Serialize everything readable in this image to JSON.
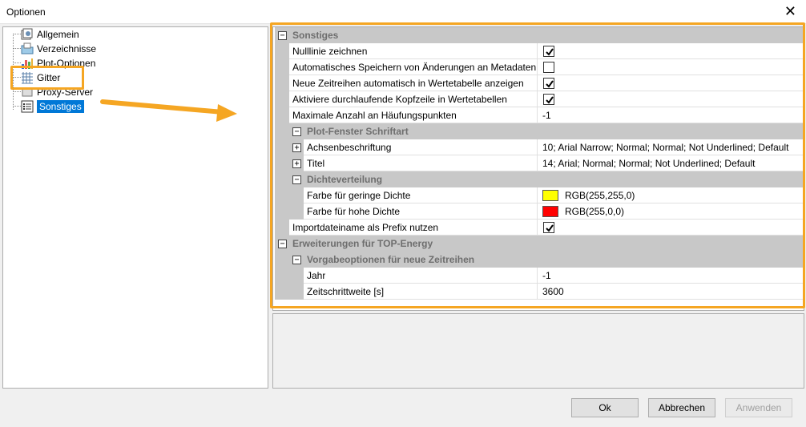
{
  "window": {
    "title": "Optionen",
    "close_glyph": "✕"
  },
  "tree": {
    "items": [
      {
        "label": "Allgemein",
        "icon": "settings-icon"
      },
      {
        "label": "Verzeichnisse",
        "icon": "folder-icon"
      },
      {
        "label": "Plot-Optionen",
        "icon": "chart-icon"
      },
      {
        "label": "Gitter",
        "icon": "grid-icon"
      },
      {
        "label": "Proxy-Server",
        "icon": "proxy-icon"
      },
      {
        "label": "Sonstiges",
        "icon": "list-icon",
        "selected": true
      }
    ]
  },
  "grid": {
    "cat_sonstiges": "Sonstiges",
    "nulllinie": {
      "label": "Nulllinie zeichnen",
      "checked": true
    },
    "autosave": {
      "label": "Automatisches Speichern von Änderungen an Metadaten",
      "checked": false
    },
    "neue_zeitreihen": {
      "label": "Neue Zeitreihen automatisch in Wertetabelle anzeigen",
      "checked": true
    },
    "kopfzeile": {
      "label": "Aktiviere durchlaufende Kopfzeile in Wertetabellen",
      "checked": true
    },
    "max_anzahl": {
      "label": "Maximale Anzahl an Häufungspunkten",
      "value": "-1"
    },
    "cat_plotfont": "Plot-Fenster Schriftart",
    "achsen": {
      "label": "Achsenbeschriftung",
      "value": "10; Arial Narrow; Normal; Normal; Not Underlined; Default"
    },
    "titel": {
      "label": "Titel",
      "value": "14; Arial; Normal; Normal; Not Underlined; Default"
    },
    "cat_dichte": "Dichteverteilung",
    "farbe_gering": {
      "label": "Farbe für geringe Dichte",
      "value": "RGB(255,255,0)",
      "color": "#ffff00"
    },
    "farbe_hoch": {
      "label": "Farbe für hohe Dichte",
      "value": "RGB(255,0,0)",
      "color": "#ff0000"
    },
    "importname": {
      "label": "Importdateiname als Prefix nutzen",
      "checked": true
    },
    "cat_erweiterungen": "Erweiterungen für TOP-Energy",
    "cat_vorgabe": "Vorgabeoptionen für neue Zeitreihen",
    "jahr": {
      "label": "Jahr",
      "value": "-1"
    },
    "zeitschritt": {
      "label": "Zeitschrittweite [s]",
      "value": "3600"
    }
  },
  "buttons": {
    "ok": "Ok",
    "cancel": "Abbrechen",
    "apply": "Anwenden"
  },
  "colors": {
    "highlight": "#f5a623",
    "selection": "#0078d7"
  }
}
